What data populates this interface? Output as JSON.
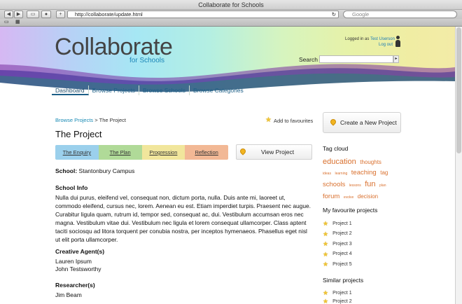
{
  "window": {
    "title": "Collaborate for Schools"
  },
  "browser": {
    "url": "http://collaborate/update.html",
    "search_placeholder": "Google"
  },
  "header": {
    "logo": "Collaborate",
    "logo_sub": "for Schools",
    "logged_in_prefix": "Logged in as",
    "user": "Test Userson",
    "logout": "Log out",
    "search_label": "Search"
  },
  "nav": [
    "Dashboard",
    "Browse Projects",
    "Browse Schools",
    "Browse Categories"
  ],
  "breadcrumb": {
    "parent": "Browse Projects",
    "sep": ">",
    "current": "The Project"
  },
  "favourites_label": "Add to favourites",
  "title": "The Project",
  "tabs": [
    "The Enquiry",
    "The Plan",
    "Progression",
    "Reflection"
  ],
  "view_button": "View Project",
  "school": {
    "label": "School:",
    "value": "Stantonbury Campus"
  },
  "info": {
    "heading": "School Info",
    "text": "Nulla dui purus, eleifend vel, consequat non, dictum porta, nulla. Duis ante mi, laoreet ut, commodo eleifend, cursus nec, lorem. Aenean eu est. Etiam imperdiet turpis. Praesent nec augue. Curabitur ligula quam, rutrum id, tempor sed, consequat ac, dui. Vestibulum accumsan eros nec magna. Vestibulum vitae dui. Vestibulum nec ligula et lorem consequat ullamcorper. Class aptent taciti sociosqu ad litora torquent per conubia nostra, per inceptos hymenaeos. Phasellus eget nisl ut elit porta ullamcorper."
  },
  "agents": {
    "heading": "Creative Agent(s)",
    "names": [
      "Lauren Ipsum",
      "John Testsworthy"
    ]
  },
  "researchers": {
    "heading": "Researcher(s)",
    "names": [
      "Jim Beam"
    ]
  },
  "sidebar": {
    "create_button": "Create a New Project",
    "tag_cloud_heading": "Tag cloud",
    "tags": [
      "education",
      "thoughts",
      "ideas",
      "learning",
      "teaching",
      "tag",
      "schools",
      "lessons",
      "fun",
      "plan",
      "forum",
      "evolve",
      "decision"
    ],
    "favourites_heading": "My favourite projects",
    "favourites": [
      "Project 1",
      "Project 2",
      "Project 3",
      "Project 4",
      "Project 5"
    ],
    "similar_heading": "Similar projects",
    "similar": [
      "Project 1",
      "Project 2"
    ]
  }
}
